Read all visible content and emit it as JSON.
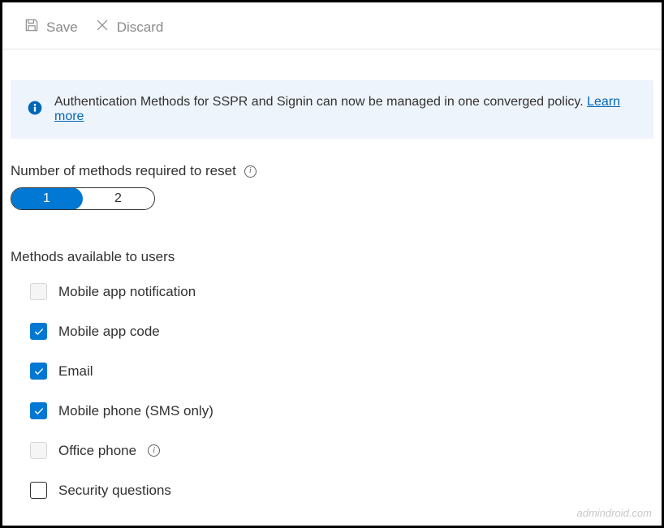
{
  "toolbar": {
    "save_label": "Save",
    "discard_label": "Discard"
  },
  "banner": {
    "text": "Authentication Methods for SSPR and Signin can now be managed in one converged policy.",
    "link_label": "Learn more"
  },
  "methods_required": {
    "label": "Number of methods required to reset",
    "options": [
      "1",
      "2"
    ],
    "selected": "1"
  },
  "methods_available": {
    "label": "Methods available to users",
    "items": [
      {
        "label": "Mobile app notification",
        "checked": false,
        "has_info": false,
        "style": "light"
      },
      {
        "label": "Mobile app code",
        "checked": true,
        "has_info": false,
        "style": "light"
      },
      {
        "label": "Email",
        "checked": true,
        "has_info": false,
        "style": "light"
      },
      {
        "label": "Mobile phone (SMS only)",
        "checked": true,
        "has_info": false,
        "style": "light"
      },
      {
        "label": "Office phone",
        "checked": false,
        "has_info": true,
        "style": "light"
      },
      {
        "label": "Security questions",
        "checked": false,
        "has_info": false,
        "style": "dark"
      }
    ]
  },
  "watermark": "admindroid.com"
}
